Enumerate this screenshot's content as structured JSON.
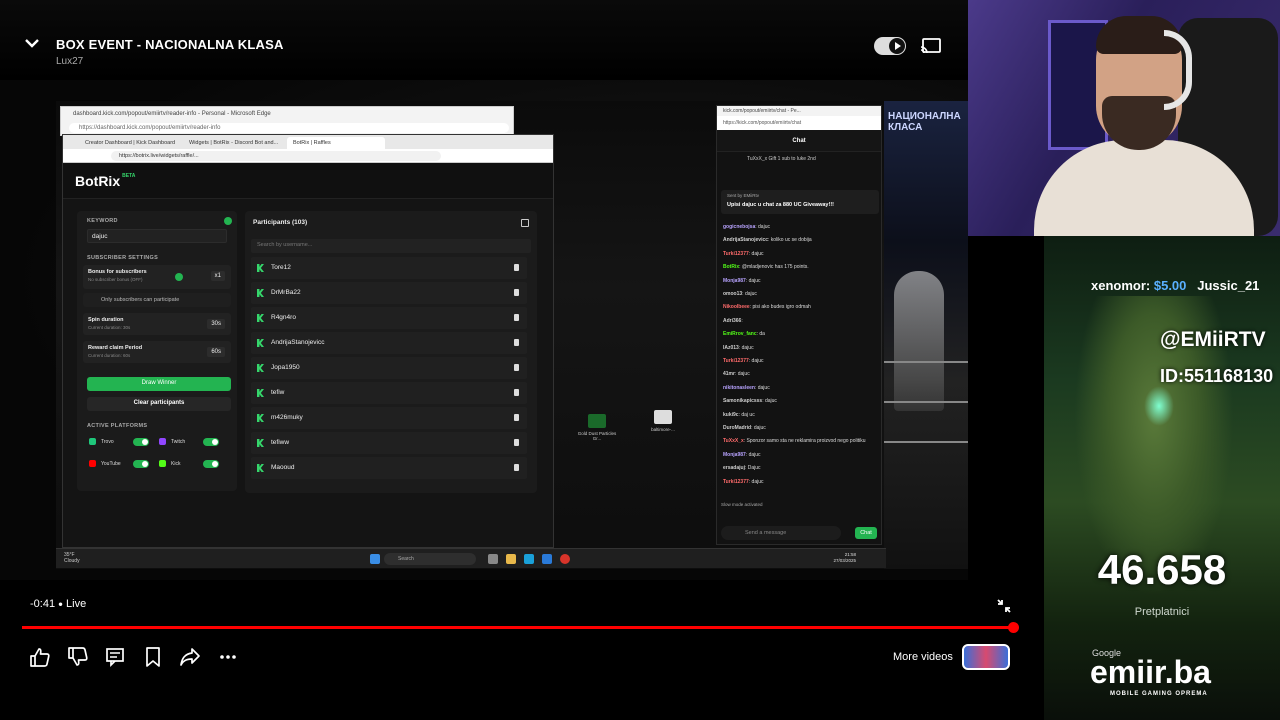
{
  "player": {
    "title": "BOX EVENT - NACIONALNA KLASA",
    "channel": "Lux27",
    "time": "-0:41",
    "live": "Live",
    "more_videos": "More videos",
    "accent": "#ff0000"
  },
  "browser": {
    "back_title": "dashboard.kick.com/popout/emiirtv/reader-info - Personal - Microsoft Edge",
    "back_url": "https://dashboard.kick.com/popout/emiirtv/reader-info",
    "tabs": [
      "Creator Dashboard | Kick Dashboard",
      "Widgets | BotRix - Discord Bot and...",
      "BotRix | Raffles"
    ],
    "url": "https://botrix.live/widgets/raffle/..."
  },
  "botrix": {
    "logo": "BotRix",
    "beta": "BETA",
    "keyword_label": "KEYWORD",
    "keyword_value": "dajuc",
    "subscriber_settings_label": "SUBSCRIBER SETTINGS",
    "bonus_title": "Bonus for subscribers",
    "bonus_sub": "No subscriber bonus (OFF)",
    "bonus_value": "x1",
    "only_subs": "Only subscribers can participate",
    "spin_title": "Spin duration",
    "spin_sub": "Current duration: 30s",
    "spin_value": "30s",
    "reward_title": "Reward claim Period",
    "reward_sub": "Current duration: 60s",
    "reward_value": "60s",
    "draw_button": "Draw Winner",
    "clear_button": "Clear participants",
    "platforms_label": "ACTIVE PLATFORMS",
    "platforms": [
      "Trovo",
      "Twitch",
      "YouTube",
      "Kick"
    ],
    "participants_title": "Participants (103)",
    "search_placeholder": "Search by username...",
    "participants": [
      "Tore12",
      "DrMrBa22",
      "R4gn4ro",
      "AndrijaStanojevicc",
      "Jopa1950",
      "tefiw",
      "m426muky",
      "tefiww",
      "Maooud"
    ]
  },
  "desktop": {
    "icons": [
      "Gold Dust Particles Gr...",
      "baltimore-..."
    ],
    "weather_temp": "35°F",
    "weather_cond": "Cloudy",
    "search": "Search",
    "clock_time": "21:58",
    "clock_date": "27/03/2025"
  },
  "chat": {
    "window_title": "kick.com/popout/emiirtv/chat - Pe...",
    "url": "https://kick.com/popout/emiirtv/chat",
    "header": "Chat",
    "gift": "TuXxX_x  Gift 1 sub to luke 2nd",
    "pinned_by": "Sent by  EMiiRtv",
    "pinned_msg": "Upisi dajuc u chat za 880 UC Giveaway!!!",
    "messages": [
      {
        "user": "gogicnebojsa",
        "text": "dajuc"
      },
      {
        "user": "AndrijaStanojevicc",
        "text": "koliko uc se dobija"
      },
      {
        "user": "Turki12377",
        "text": "dajuc"
      },
      {
        "user": "BotRix",
        "text": "@mladjenovic has 175 points."
      },
      {
        "user": "Monja987",
        "text": "dajuc"
      },
      {
        "user": "omoo13",
        "text": "dajuc"
      },
      {
        "user": "Nikoolbeee",
        "text": "pisi ako budes igro odmah"
      },
      {
        "user": "Adri366",
        "text": ""
      },
      {
        "user": "EmiRrov_fanc",
        "text": "da"
      },
      {
        "user": "IAz013",
        "text": "dajuc"
      },
      {
        "user": "Turki12377",
        "text": "dajuc"
      },
      {
        "user": "41mr",
        "text": "dajuc"
      },
      {
        "user": "nikitonasleen",
        "text": "dajuc"
      },
      {
        "user": "Samonikapicsss",
        "text": "dajuc"
      },
      {
        "user": "kuki9c",
        "text": "daj uc"
      },
      {
        "user": "DuroMadrid",
        "text": "dajuc"
      },
      {
        "user": "TuXxX_x",
        "text": "Sponzor samo sta ne reklamira proizvod nego politiku"
      },
      {
        "user": "Monja987",
        "text": "dajuc"
      },
      {
        "user": "ersadajuj",
        "text": "Dajuc"
      },
      {
        "user": "Turki12377",
        "text": "dajuc"
      }
    ],
    "slow_mode": "Slow mode activated",
    "send_placeholder": "Send a message",
    "send_button": "Chat"
  },
  "overlay": {
    "arena_sign": "НАЦИОНАЛНА КЛАСА",
    "donor_name": "xenomor:",
    "donor_amount": "$5.00",
    "donor_next": "Jussic_21",
    "handle": "@EMiiRTV",
    "uid": "ID:551168130",
    "sub_count": "46.658",
    "sub_label": "Pretplatnici",
    "google": "Google",
    "brand": "emiir.ba",
    "tagline": "MOBILE GAMING OPREMA"
  }
}
